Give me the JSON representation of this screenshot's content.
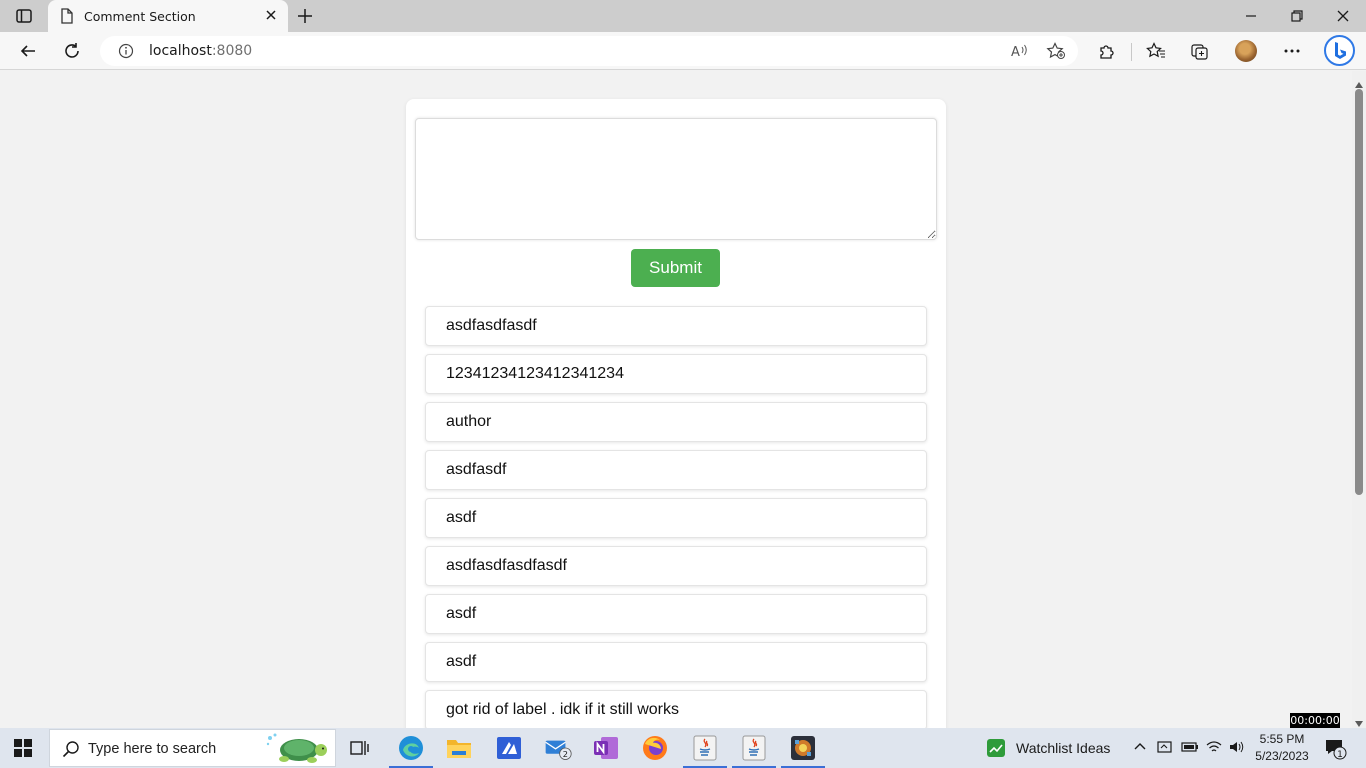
{
  "browser": {
    "tab_title": "Comment Section",
    "url_host": "localhost",
    "url_port": ":8080"
  },
  "page": {
    "textarea_value": "",
    "submit_label": "Submit",
    "comments": [
      "asdfasdfasdf",
      "12341234123412341234",
      "author",
      "asdfasdf",
      "asdf",
      "asdfasdfasdfasdf",
      "asdf",
      "asdf",
      "got rid of label . idk if it still works"
    ]
  },
  "overlay": {
    "timer": "00:00:00"
  },
  "taskbar": {
    "search_placeholder": "Type here to search",
    "mail_badge": "2",
    "widget_label": "Watchlist Ideas",
    "time": "5:55 PM",
    "date": "5/23/2023",
    "notification_count": "1"
  },
  "colors": {
    "submit_bg": "#4caf50",
    "page_bg": "#f2f2f2",
    "tabstrip_bg": "#cdcdcd"
  },
  "icons": [
    "tab-actions-icon",
    "page-icon",
    "close-icon",
    "plus-icon",
    "minimize-icon",
    "restore-icon",
    "back-icon",
    "refresh-icon",
    "info-icon",
    "read-aloud-icon",
    "add-favorite-icon",
    "extensions-icon",
    "favorites-icon",
    "collections-icon",
    "avatar",
    "more-icon",
    "bing-icon",
    "search-icon",
    "windows-start-icon",
    "task-view-icon",
    "edge-icon",
    "file-explorer-icon",
    "app-icon",
    "mail-icon",
    "onenote-icon",
    "firefox-icon",
    "java-icon",
    "game-icon",
    "widget-icon",
    "chevron-up-icon",
    "network-icon",
    "wifi-icon",
    "volume-icon",
    "notification-icon"
  ]
}
